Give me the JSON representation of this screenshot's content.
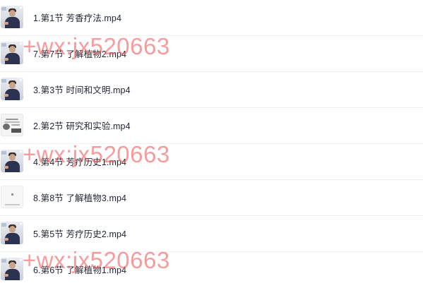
{
  "files": [
    {
      "name": "1.第1节 芳香疗法.mp4",
      "thumb": "person"
    },
    {
      "name": "7.第7节 了解植物2.mp4",
      "thumb": "person"
    },
    {
      "name": "3.第3节 时间和文明.mp4",
      "thumb": "person"
    },
    {
      "name": "2.第2节 研究和实验.mp4",
      "thumb": "slide"
    },
    {
      "name": "4.第4节 芳疗历史1.mp4",
      "thumb": "person"
    },
    {
      "name": "8.第8节 了解植物3.mp4",
      "thumb": "blank"
    },
    {
      "name": "5.第5节 芳疗历史2.mp4",
      "thumb": "person"
    },
    {
      "name": "6.第6节 了解植物1.mp4",
      "thumb": "person"
    }
  ],
  "watermark": {
    "text": "+wx:jx520663",
    "color": "#f05f5f"
  }
}
